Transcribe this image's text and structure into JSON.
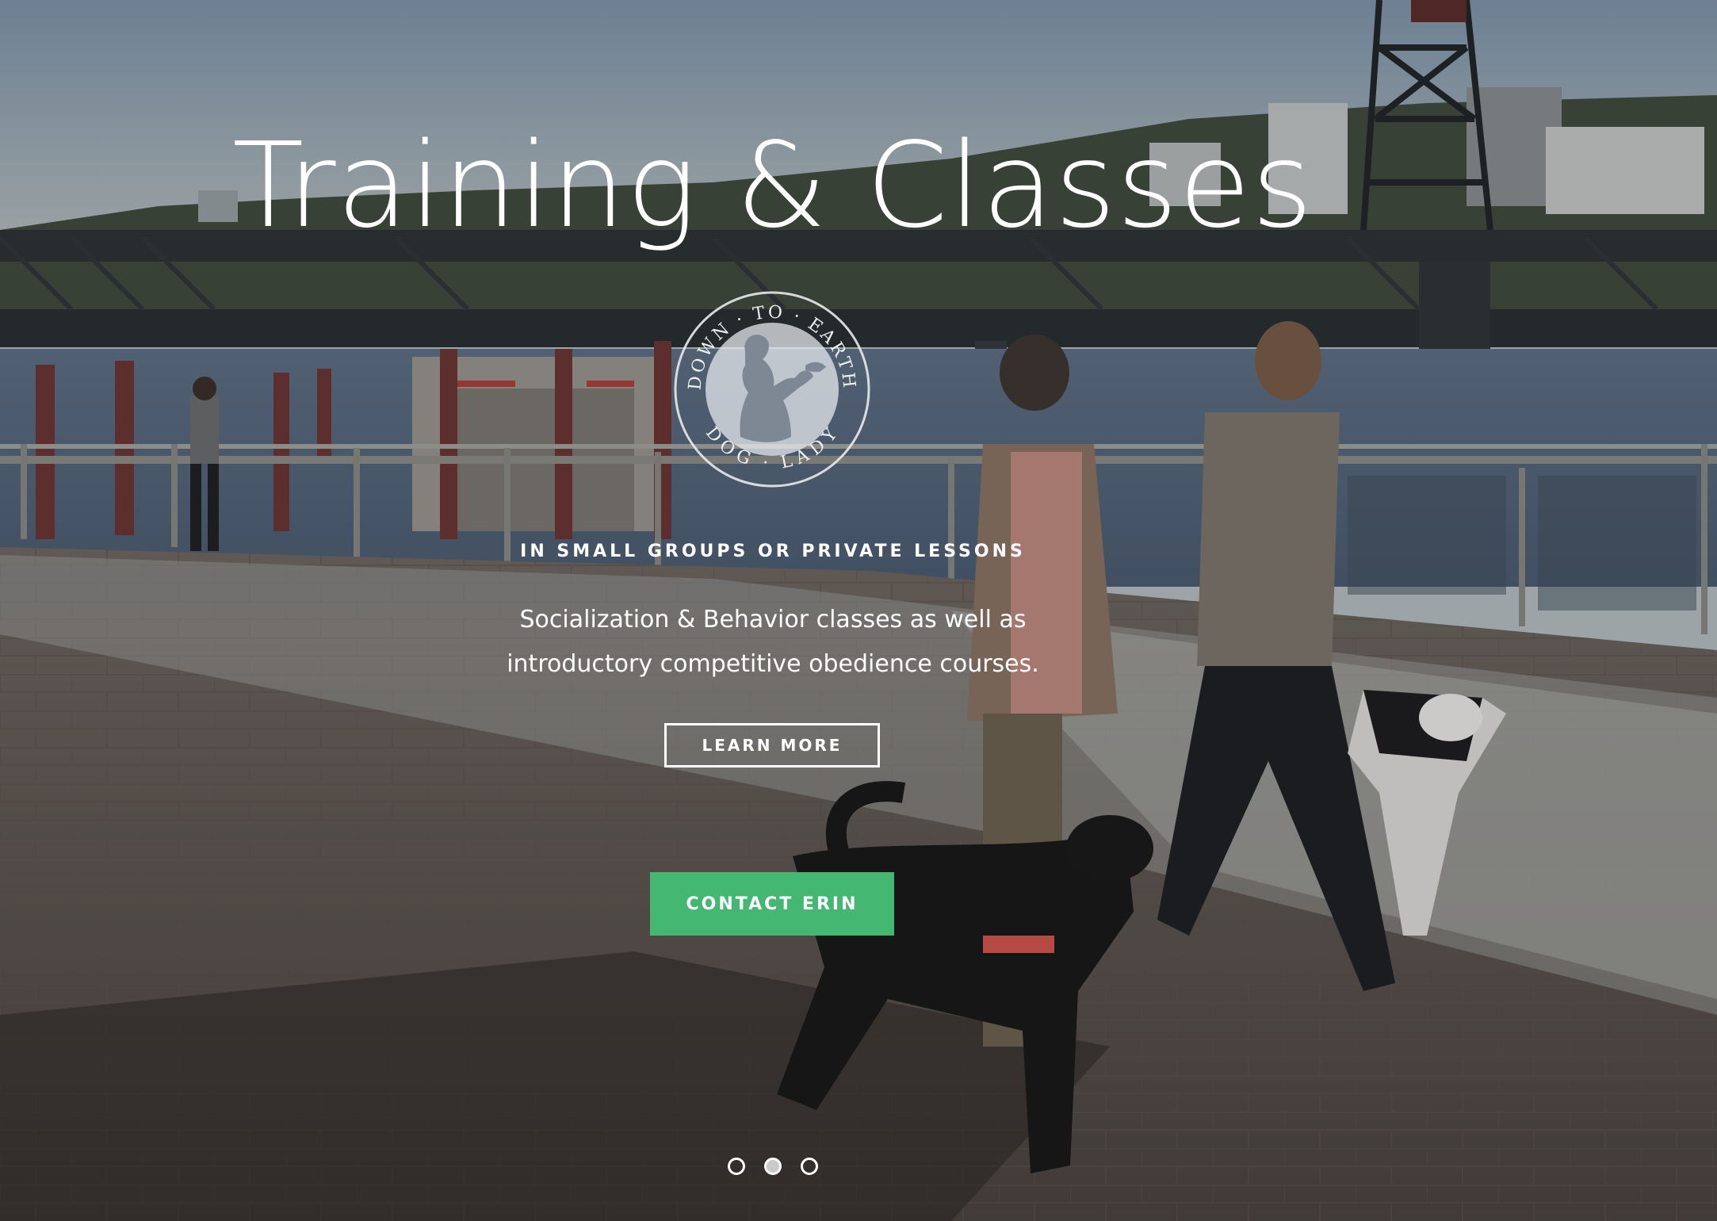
{
  "hero": {
    "title": "Training & Classes",
    "logo": {
      "top_text": "DOWN · TO · EARTH",
      "bottom_text": "DOG · LADY"
    },
    "subtitle": "IN SMALL GROUPS OR PRIVATE LESSONS",
    "description": "Socialization & Behavior classes as well as introductory competitive obedience courses.",
    "learn_more_label": "LEARN MORE",
    "contact_label": "CONTACT ERIN"
  },
  "carousel": {
    "slides": 3,
    "active_index": 1
  },
  "colors": {
    "accent_green": "#44b773",
    "text": "#ffffff"
  }
}
